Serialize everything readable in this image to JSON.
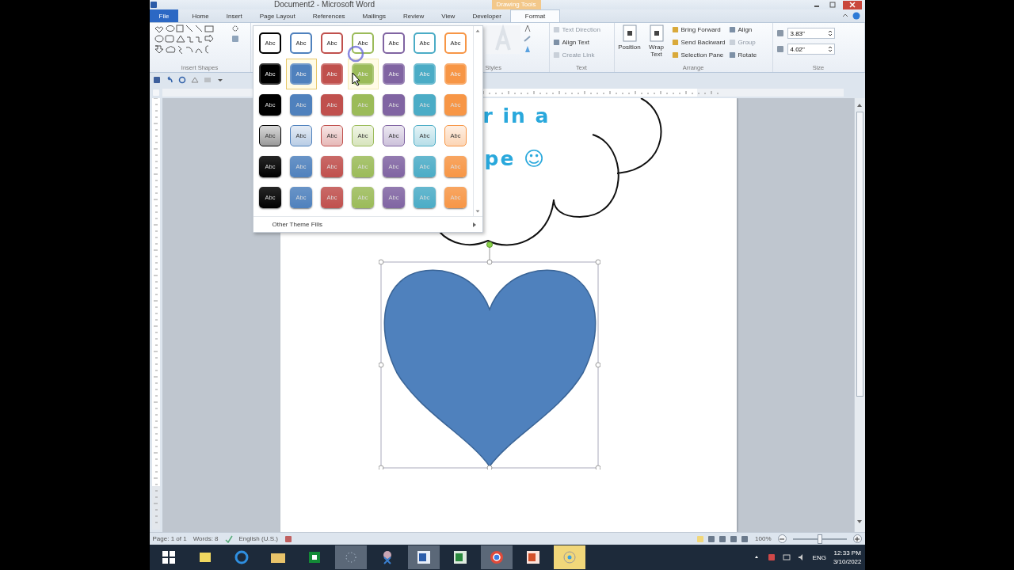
{
  "window": {
    "title": "Document2 - Microsoft Word",
    "contextual_tab": "Drawing Tools"
  },
  "tabs": [
    {
      "label": "File",
      "kind": "file",
      "selected": false
    },
    {
      "label": "Home",
      "kind": "tab",
      "selected": false
    },
    {
      "label": "Insert",
      "kind": "tab",
      "selected": false
    },
    {
      "label": "Page Layout",
      "kind": "tab",
      "selected": false
    },
    {
      "label": "References",
      "kind": "tab",
      "selected": false
    },
    {
      "label": "Mailings",
      "kind": "tab",
      "selected": false
    },
    {
      "label": "Review",
      "kind": "tab",
      "selected": false
    },
    {
      "label": "View",
      "kind": "tab",
      "selected": false
    },
    {
      "label": "Developer",
      "kind": "tab",
      "selected": false
    },
    {
      "label": "Format",
      "kind": "contextual",
      "selected": true
    }
  ],
  "ribbon": {
    "insert_shapes": {
      "label": "Insert Shapes"
    },
    "wordart": {
      "label": "Styles"
    },
    "text": {
      "label": "Text",
      "items": [
        {
          "label": "Text Direction",
          "disabled": true
        },
        {
          "label": "Align Text",
          "disabled": false
        },
        {
          "label": "Create Link",
          "disabled": true
        }
      ]
    },
    "arrange": {
      "label": "Arrange",
      "large": [
        {
          "label": "Position"
        },
        {
          "label": "Wrap Text"
        }
      ],
      "items": [
        {
          "label": "Bring Forward",
          "disabled": false
        },
        {
          "label": "Send Backward",
          "disabled": false
        },
        {
          "label": "Selection Pane",
          "disabled": false
        },
        {
          "label": "Align",
          "disabled": false
        },
        {
          "label": "Group",
          "disabled": true
        },
        {
          "label": "Rotate",
          "disabled": false
        }
      ]
    },
    "size": {
      "label": "Size",
      "height": "3.83\"",
      "width": "4.02\""
    }
  },
  "gallery": {
    "rows": [
      {
        "kind": "outline",
        "items": [
          {
            "label": "Abc",
            "color": "#000000",
            "selected": false,
            "hovered": false
          },
          {
            "label": "Abc",
            "color": "#4f81bd",
            "selected": false,
            "hovered": false
          },
          {
            "label": "Abc",
            "color": "#c0504d",
            "selected": false,
            "hovered": false
          },
          {
            "label": "Abc",
            "color": "#9bbb59",
            "selected": false,
            "hovered": false
          },
          {
            "label": "Abc",
            "color": "#8064a2",
            "selected": false,
            "hovered": false
          },
          {
            "label": "Abc",
            "color": "#4bacc6",
            "selected": false,
            "hovered": false
          },
          {
            "label": "Abc",
            "color": "#f79646",
            "selected": false,
            "hovered": false
          }
        ]
      },
      {
        "kind": "solid",
        "items": [
          {
            "label": "Abc",
            "color": "#000000",
            "selected": false,
            "hovered": false
          },
          {
            "label": "Abc",
            "color": "#4f81bd",
            "selected": true,
            "hovered": false
          },
          {
            "label": "Abc",
            "color": "#c0504d",
            "selected": false,
            "hovered": false
          },
          {
            "label": "Abc",
            "color": "#9bbb59",
            "selected": false,
            "hovered": true
          },
          {
            "label": "Abc",
            "color": "#8064a2",
            "selected": false,
            "hovered": false
          },
          {
            "label": "Abc",
            "color": "#4bacc6",
            "selected": false,
            "hovered": false
          },
          {
            "label": "Abc",
            "color": "#f79646",
            "selected": false,
            "hovered": false
          }
        ]
      },
      {
        "kind": "subtle",
        "items": [
          {
            "label": "Abc",
            "color": "#000000",
            "selected": false,
            "hovered": false
          },
          {
            "label": "Abc",
            "color": "#4f81bd",
            "selected": false,
            "hovered": false
          },
          {
            "label": "Abc",
            "color": "#c0504d",
            "selected": false,
            "hovered": false
          },
          {
            "label": "Abc",
            "color": "#9bbb59",
            "selected": false,
            "hovered": false
          },
          {
            "label": "Abc",
            "color": "#8064a2",
            "selected": false,
            "hovered": false
          },
          {
            "label": "Abc",
            "color": "#4bacc6",
            "selected": false,
            "hovered": false
          },
          {
            "label": "Abc",
            "color": "#f79646",
            "selected": false,
            "hovered": false
          }
        ]
      },
      {
        "kind": "light",
        "items": [
          {
            "label": "Abc",
            "color": "#000000",
            "selected": false,
            "hovered": false
          },
          {
            "label": "Abc",
            "color": "#4f81bd",
            "selected": false,
            "hovered": false
          },
          {
            "label": "Abc",
            "color": "#c0504d",
            "selected": false,
            "hovered": false
          },
          {
            "label": "Abc",
            "color": "#9bbb59",
            "selected": false,
            "hovered": false
          },
          {
            "label": "Abc",
            "color": "#8064a2",
            "selected": false,
            "hovered": false
          },
          {
            "label": "Abc",
            "color": "#4bacc6",
            "selected": false,
            "hovered": false
          },
          {
            "label": "Abc",
            "color": "#f79646",
            "selected": false,
            "hovered": false
          }
        ]
      },
      {
        "kind": "intense",
        "items": [
          {
            "label": "Abc",
            "color": "#000000",
            "selected": false,
            "hovered": false
          },
          {
            "label": "Abc",
            "color": "#4f81bd",
            "selected": false,
            "hovered": false
          },
          {
            "label": "Abc",
            "color": "#c0504d",
            "selected": false,
            "hovered": false
          },
          {
            "label": "Abc",
            "color": "#9bbb59",
            "selected": false,
            "hovered": false
          },
          {
            "label": "Abc",
            "color": "#8064a2",
            "selected": false,
            "hovered": false
          },
          {
            "label": "Abc",
            "color": "#4bacc6",
            "selected": false,
            "hovered": false
          },
          {
            "label": "Abc",
            "color": "#f79646",
            "selected": false,
            "hovered": false
          }
        ]
      },
      {
        "kind": "intense",
        "items": [
          {
            "label": "Abc",
            "color": "#000000",
            "selected": false,
            "hovered": false
          },
          {
            "label": "Abc",
            "color": "#4f81bd",
            "selected": false,
            "hovered": false
          },
          {
            "label": "Abc",
            "color": "#c0504d",
            "selected": false,
            "hovered": false
          },
          {
            "label": "Abc",
            "color": "#9bbb59",
            "selected": false,
            "hovered": false
          },
          {
            "label": "Abc",
            "color": "#8064a2",
            "selected": false,
            "hovered": false
          },
          {
            "label": "Abc",
            "color": "#4bacc6",
            "selected": false,
            "hovered": false
          },
          {
            "label": "Abc",
            "color": "#f79646",
            "selected": false,
            "hovered": false
          }
        ]
      }
    ],
    "footer": "Other Theme Fills"
  },
  "document": {
    "lines": [
      "r in a",
      "pe ☺"
    ]
  },
  "status_bar": {
    "page": "Page: 1 of 1",
    "words": "Words: 8",
    "language": "English (U.S.)",
    "zoom": "100%",
    "level": 0.5
  },
  "taskbar": {
    "language": "ENG",
    "time": "12:33 PM",
    "date": "3/10/2022"
  }
}
